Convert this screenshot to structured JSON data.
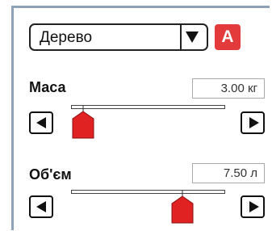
{
  "material_select": {
    "value": "Дерево"
  },
  "badge": {
    "label": "A",
    "color": "#e33b3b"
  },
  "mass": {
    "label": "Маса",
    "value": "3.00 кг",
    "slider_fraction": 0.08
  },
  "volume": {
    "label": "Об'єм",
    "value": "7.50 л",
    "slider_fraction": 0.72
  },
  "icons": {
    "dropdown": "chevron-down-icon",
    "decrement": "arrow-left-icon",
    "increment": "arrow-right-icon"
  }
}
